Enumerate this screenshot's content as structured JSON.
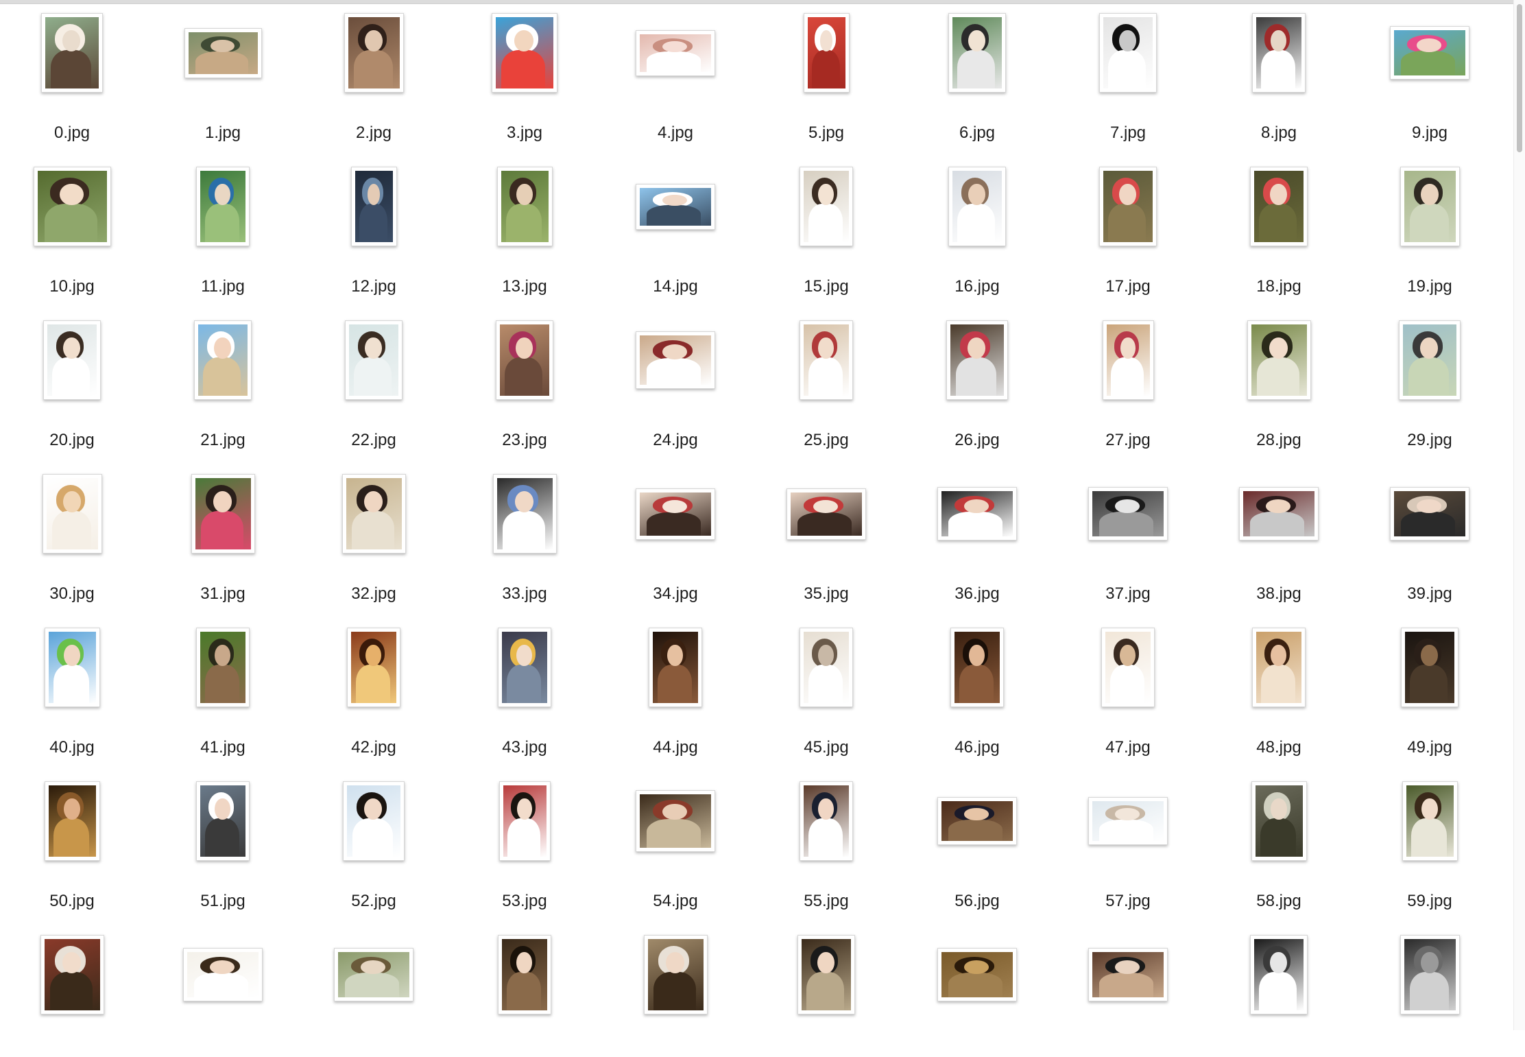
{
  "window": {
    "title": ""
  },
  "items": [
    {
      "name": "0.jpg"
    },
    {
      "name": "1.jpg"
    },
    {
      "name": "2.jpg"
    },
    {
      "name": "3.jpg"
    },
    {
      "name": "4.jpg"
    },
    {
      "name": "5.jpg"
    },
    {
      "name": "6.jpg"
    },
    {
      "name": "7.jpg"
    },
    {
      "name": "8.jpg"
    },
    {
      "name": "9.jpg"
    },
    {
      "name": "10.jpg"
    },
    {
      "name": "11.jpg"
    },
    {
      "name": "12.jpg"
    },
    {
      "name": "13.jpg"
    },
    {
      "name": "14.jpg"
    },
    {
      "name": "15.jpg"
    },
    {
      "name": "16.jpg"
    },
    {
      "name": "17.jpg"
    },
    {
      "name": "18.jpg"
    },
    {
      "name": "19.jpg"
    },
    {
      "name": "20.jpg"
    },
    {
      "name": "21.jpg"
    },
    {
      "name": "22.jpg"
    },
    {
      "name": "23.jpg"
    },
    {
      "name": "24.jpg"
    },
    {
      "name": "25.jpg"
    },
    {
      "name": "26.jpg"
    },
    {
      "name": "27.jpg"
    },
    {
      "name": "28.jpg"
    },
    {
      "name": "29.jpg"
    },
    {
      "name": "30.jpg"
    },
    {
      "name": "31.jpg"
    },
    {
      "name": "32.jpg"
    },
    {
      "name": "33.jpg"
    },
    {
      "name": "34.jpg"
    },
    {
      "name": "35.jpg"
    },
    {
      "name": "36.jpg"
    },
    {
      "name": "37.jpg"
    },
    {
      "name": "38.jpg"
    },
    {
      "name": "39.jpg"
    },
    {
      "name": "40.jpg"
    },
    {
      "name": "41.jpg"
    },
    {
      "name": "42.jpg"
    },
    {
      "name": "43.jpg"
    },
    {
      "name": "44.jpg"
    },
    {
      "name": "45.jpg"
    },
    {
      "name": "46.jpg"
    },
    {
      "name": "47.jpg"
    },
    {
      "name": "48.jpg"
    },
    {
      "name": "49.jpg"
    },
    {
      "name": "50.jpg"
    },
    {
      "name": "51.jpg"
    },
    {
      "name": "52.jpg"
    },
    {
      "name": "53.jpg"
    },
    {
      "name": "54.jpg"
    },
    {
      "name": "55.jpg"
    },
    {
      "name": "56.jpg"
    },
    {
      "name": "57.jpg"
    },
    {
      "name": "58.jpg"
    },
    {
      "name": "59.jpg"
    },
    {
      "name": ""
    },
    {
      "name": ""
    },
    {
      "name": ""
    },
    {
      "name": ""
    },
    {
      "name": ""
    },
    {
      "name": ""
    },
    {
      "name": ""
    },
    {
      "name": ""
    },
    {
      "name": ""
    },
    {
      "name": ""
    }
  ],
  "thumb_palettes": [
    [
      "#8fae8c",
      "#e9dccd",
      "#f6eee4",
      "#5b4636"
    ],
    [
      "#7d8f6a",
      "#d9c2a8",
      "#3f4a34",
      "#c7a985"
    ],
    [
      "#6b4e3c",
      "#e0c7b0",
      "#2f2019",
      "#b08a6b"
    ],
    [
      "#3aa3d9",
      "#f2d6bf",
      "#ffffff",
      "#e9423a"
    ],
    [
      "#e3b8ad",
      "#f5ddd5",
      "#c98f80",
      "#ffffff"
    ],
    [
      "#d9473a",
      "#f2e0d2",
      "#ffffff",
      "#a62a22"
    ],
    [
      "#5f8a5a",
      "#f1e3d3",
      "#2b2b2b",
      "#e8e8e8"
    ],
    [
      "#e4e4e4",
      "#c9c9c9",
      "#111111",
      "#ffffff"
    ],
    [
      "#3b3b3b",
      "#e6d6c6",
      "#9e2b2b",
      "#ffffff"
    ],
    [
      "#5aa9cf",
      "#f3d6c9",
      "#e84c8b",
      "#7aa55a"
    ],
    [
      "#556b2f",
      "#f2dcc8",
      "#3b2a20",
      "#8fa76b"
    ],
    [
      "#3c7a3c",
      "#e9d7c3",
      "#2a6fa8",
      "#9ac07a"
    ],
    [
      "#1f2a3a",
      "#e4cbb5",
      "#6a87a6",
      "#3b4d66"
    ],
    [
      "#5d7a3a",
      "#e6cfb6",
      "#3a2a20",
      "#9bb36b"
    ],
    [
      "#8ec3ea",
      "#f1d9c8",
      "#ffffff",
      "#3a4e63"
    ],
    [
      "#d7cfc1",
      "#f3e3d3",
      "#3b2c22",
      "#ffffff"
    ],
    [
      "#d8dde3",
      "#e9cfb8",
      "#8a6f5a",
      "#ffffff"
    ],
    [
      "#5b5a3a",
      "#f0d6c4",
      "#d94a4a",
      "#8a7a50"
    ],
    [
      "#4a4a2a",
      "#f0d6c4",
      "#d94a4a",
      "#6b6b3a"
    ],
    [
      "#a7b68b",
      "#e9d3be",
      "#2f2a22",
      "#cfd7bd"
    ],
    [
      "#dfe6e6",
      "#f1dfce",
      "#3a2c22",
      "#ffffff"
    ],
    [
      "#7bb8e6",
      "#f2d3bd",
      "#ffffff",
      "#d8c39a"
    ],
    [
      "#d6e4e4",
      "#f0e0d0",
      "#3a2c22",
      "#eef3f3"
    ],
    [
      "#b88b6a",
      "#f0d3bd",
      "#a8325a",
      "#6a4a3a"
    ],
    [
      "#caa98a",
      "#efd8c6",
      "#8a2a2a",
      "#ffffff"
    ],
    [
      "#d7c2a8",
      "#f1dccb",
      "#b03a3a",
      "#ffffff"
    ],
    [
      "#4a3a2a",
      "#efd6c2",
      "#c23a4a",
      "#e2e2e2"
    ],
    [
      "#caa47a",
      "#f1dccb",
      "#b83a4a",
      "#ffffff"
    ],
    [
      "#7a8a4a",
      "#f1dccb",
      "#2a2a1a",
      "#e6e6d6"
    ],
    [
      "#9fc0c8",
      "#ecd6c2",
      "#3a3a3a",
      "#c8d6b6"
    ],
    [
      "#ffffff",
      "#f1d6b6",
      "#d6a86a",
      "#f5efe6"
    ],
    [
      "#4a7a3a",
      "#f0d4c0",
      "#2a1f1a",
      "#d94a6a"
    ],
    [
      "#c7b48f",
      "#efd6c2",
      "#2a1f1a",
      "#e8e0d0"
    ],
    [
      "#2a2a2a",
      "#f0d8c6",
      "#6a8ac2",
      "#ffffff"
    ],
    [
      "#e9d6c6",
      "#f5e6da",
      "#b83a3a",
      "#3a2a22"
    ],
    [
      "#e6d0c0",
      "#f3e3d6",
      "#c23a3a",
      "#3a2a22"
    ],
    [
      "#1f1f1f",
      "#efd6c2",
      "#c23a3a",
      "#ffffff"
    ],
    [
      "#3a3a3a",
      "#e6e6e6",
      "#1a1a1a",
      "#9a9a9a"
    ],
    [
      "#6a2a2a",
      "#efd6c2",
      "#2a1a1a",
      "#c8c8c8"
    ],
    [
      "#5a4a3a",
      "#efd8c8",
      "#d8c8b8",
      "#2a2a2a"
    ],
    [
      "#5aa3d9",
      "#f0d6c2",
      "#6ac04a",
      "#ffffff"
    ],
    [
      "#4a7a2a",
      "#c8a88a",
      "#2a2a1a",
      "#8a6a4a"
    ],
    [
      "#8a3a1a",
      "#e6b06a",
      "#3a1a0a",
      "#f0c87a"
    ],
    [
      "#3a3a4a",
      "#f1dccb",
      "#e8b84a",
      "#7a8aa0"
    ],
    [
      "#1f120a",
      "#e6c0a0",
      "#3a2010",
      "#8a5a3a"
    ],
    [
      "#e6ded2",
      "#c8b8a6",
      "#6a5a4a",
      "#ffffff"
    ],
    [
      "#3a2010",
      "#e2b896",
      "#1a0f08",
      "#8a5a3a"
    ],
    [
      "#f1e6d8",
      "#d8b896",
      "#3a2a20",
      "#ffffff"
    ],
    [
      "#caa06a",
      "#e6c0a0",
      "#3a2010",
      "#f2e2ce"
    ],
    [
      "#1a1410",
      "#8a6a4a",
      "#2a1f18",
      "#4a3a2a"
    ],
    [
      "#2a1a0a",
      "#e0b08a",
      "#8a5a2a",
      "#c8964a"
    ],
    [
      "#6a7a8a",
      "#f0d6c4",
      "#ffffff",
      "#3a3a3a"
    ],
    [
      "#cfe0ee",
      "#f0d8c6",
      "#1a1410",
      "#ffffff"
    ],
    [
      "#b83a3a",
      "#f2dccb",
      "#1a1410",
      "#ffffff"
    ],
    [
      "#3a2a1a",
      "#e8cdb6",
      "#8a3a2a",
      "#c8b89a"
    ],
    [
      "#5a3a2a",
      "#f0d6c4",
      "#1a2030",
      "#ffffff"
    ],
    [
      "#4a2a1a",
      "#e6c4a6",
      "#1a1a2a",
      "#8a6a4a"
    ],
    [
      "#dfe8ee",
      "#f2e6da",
      "#c8b8a6",
      "#ffffff"
    ],
    [
      "#6a6a5a",
      "#e8d8c8",
      "#d0d0c0",
      "#3a3a2a"
    ],
    [
      "#4a5a2a",
      "#f0dccb",
      "#3a2a1a",
      "#e8e6d8"
    ],
    [
      "#8a3a2a",
      "#f1dccb",
      "#e8e0d6",
      "#3a2a1a"
    ],
    [
      "#f4f1ea",
      "#efd6c2",
      "#3a2a1a",
      "#ffffff"
    ],
    [
      "#8a9a6a",
      "#e6d6c2",
      "#6a5a3a",
      "#d0d6c0"
    ],
    [
      "#3a2a1a",
      "#efd6c2",
      "#1a120a",
      "#8a6a4a"
    ],
    [
      "#a08a6a",
      "#efd8c6",
      "#e8e0d6",
      "#3a2a1a"
    ],
    [
      "#3a2a1a",
      "#efd6c2",
      "#1a1a1a",
      "#b8a88a"
    ],
    [
      "#7a5a2a",
      "#c8a060",
      "#2a1a0a",
      "#a08050"
    ],
    [
      "#5a3a2a",
      "#e8d2c0",
      "#1a1a1a",
      "#c8a88a"
    ],
    [
      "#1a1a1a",
      "#e6e6e6",
      "#3a3a3a",
      "#ffffff"
    ],
    [
      "#2a2a2a",
      "#9a9a9a",
      "#6a6a6a",
      "#d0d0d0"
    ]
  ]
}
